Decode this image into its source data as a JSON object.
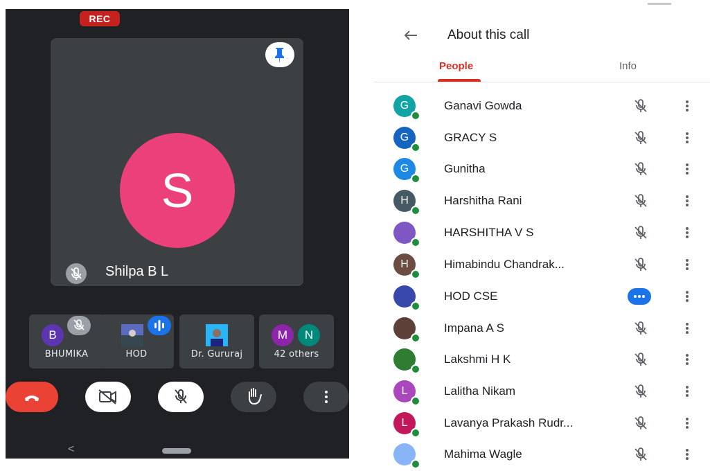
{
  "call": {
    "rec_badge": "REC",
    "main_speaker": {
      "initial": "S",
      "name": "Shilpa B L",
      "avatar_color": "#ec407a"
    },
    "thumbnails": [
      {
        "label": "BHUMIKA",
        "initial": "B",
        "avatar_color": "#5e35b1"
      },
      {
        "label": "HOD"
      },
      {
        "label": "Dr. Gururaj"
      },
      {
        "label": "42 others",
        "initials": [
          "M",
          "N"
        ],
        "colors": [
          "#8e24aa",
          "#00897b"
        ]
      }
    ],
    "controls": [
      "end-call",
      "camera-off",
      "mic-off",
      "raise-hand",
      "more-options"
    ],
    "accent_end_call": "#ea4335"
  },
  "panel": {
    "title": "About this call",
    "tabs": {
      "people": "People",
      "info": "Info"
    },
    "accent": "#d93025",
    "participants": [
      {
        "initial": "G",
        "name": "Ganavi Gowda",
        "color": "#12a4a4",
        "mic": "muted"
      },
      {
        "initial": "G",
        "name": "GRACY S",
        "color": "#1565c0",
        "mic": "muted"
      },
      {
        "initial": "G",
        "name": "Gunitha",
        "color": "#1e88e5",
        "mic": "muted"
      },
      {
        "initial": "H",
        "name": "Harshitha Rani",
        "color": "#455a64",
        "mic": "muted"
      },
      {
        "initial": "",
        "name": "HARSHITHA V S",
        "color": "#7e57c2",
        "mic": "muted"
      },
      {
        "initial": "H",
        "name": "Himabindu Chandrak...",
        "color": "#6d4c41",
        "mic": "muted"
      },
      {
        "initial": "",
        "name": "HOD CSE",
        "color": "#3949ab",
        "mic": "speaking"
      },
      {
        "initial": "",
        "name": "Impana A S",
        "color": "#5d4037",
        "mic": "muted"
      },
      {
        "initial": "",
        "name": "Lakshmi H K",
        "color": "#2e7d32",
        "mic": "muted"
      },
      {
        "initial": "L",
        "name": "Lalitha Nikam",
        "color": "#ab47bc",
        "mic": "muted"
      },
      {
        "initial": "L",
        "name": "Lavanya Prakash Rudr...",
        "color": "#c2185b",
        "mic": "muted"
      },
      {
        "initial": "",
        "name": "Mahima Wagle",
        "color": "#8ab4f8",
        "mic": "muted"
      }
    ]
  }
}
